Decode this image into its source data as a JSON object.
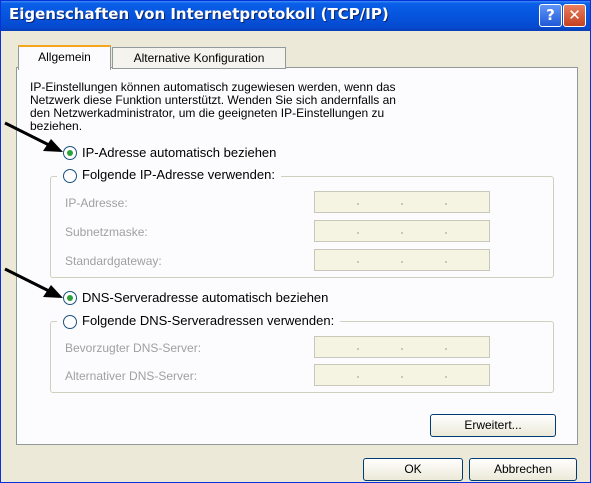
{
  "window": {
    "title": "Eigenschaften von Internetprotokoll (TCP/IP)",
    "help_label": "?",
    "close_label": "✕"
  },
  "tabs": [
    {
      "label": "Allgemein",
      "selected": true
    },
    {
      "label": "Alternative Konfiguration",
      "selected": false
    }
  ],
  "intro_text": "IP-Einstellungen können automatisch zugewiesen werden, wenn das\nNetzwerk diese Funktion unterstützt. Wenden Sie sich andernfalls an\nden Netzwerkadministrator, um die geeigneten IP-Einstellungen zu\nbeziehen.",
  "ip": {
    "auto_label": "IP-Adresse automatisch beziehen",
    "auto_selected": true,
    "manual_label": "Folgende IP-Adresse verwenden:",
    "fields": [
      {
        "label": "IP-Adresse:"
      },
      {
        "label": "Subnetzmaske:"
      },
      {
        "label": "Standardgateway:"
      }
    ]
  },
  "dns": {
    "auto_label": "DNS-Serveradresse automatisch beziehen",
    "auto_selected": true,
    "manual_label": "Folgende DNS-Serveradressen verwenden:",
    "fields": [
      {
        "label": "Bevorzugter DNS-Server:"
      },
      {
        "label": "Alternativer DNS-Server:"
      }
    ]
  },
  "buttons": {
    "advanced": "Erweitert...",
    "ok": "OK",
    "cancel": "Abbrechen"
  },
  "colors": {
    "titlebar": "#0654dd",
    "dialog_bg": "#ece9d8",
    "tab_highlight": "#f6a51e",
    "radio_dot": "#2aa13c",
    "disabled_text": "#a0a0a0"
  }
}
